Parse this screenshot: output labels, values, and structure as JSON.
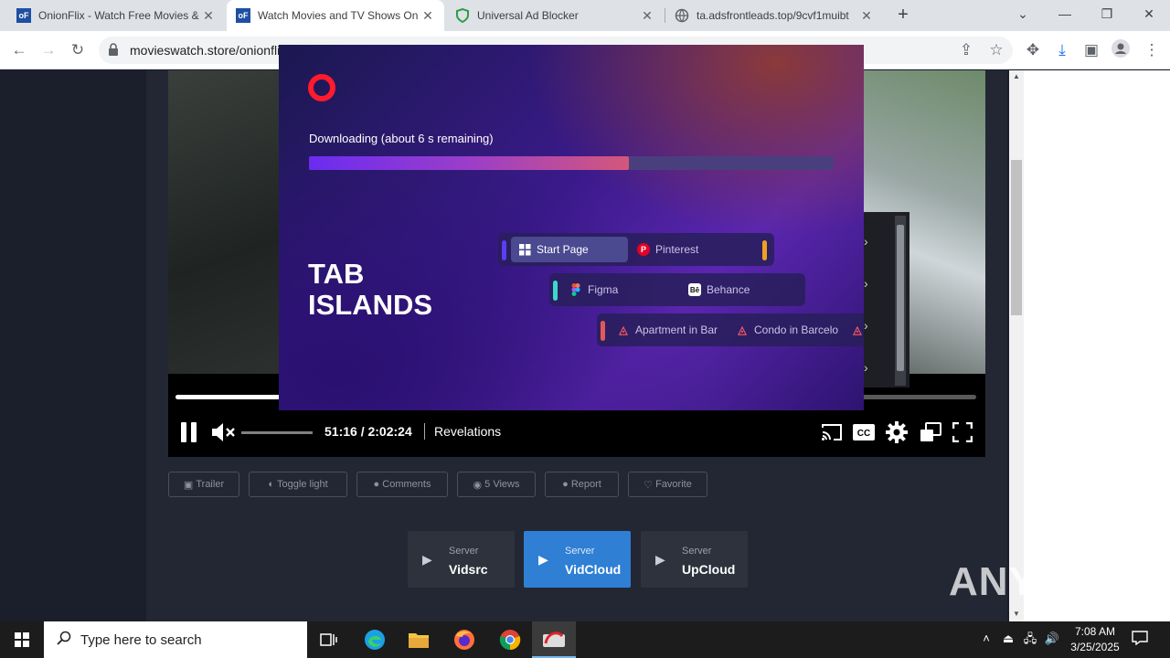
{
  "browser": {
    "tabs": [
      {
        "title": "OnionFlix - Watch Free Movies &",
        "favicon": "oF"
      },
      {
        "title": "Watch Movies and TV Shows On",
        "favicon": "oF"
      },
      {
        "title": "Universal Ad Blocker",
        "favicon": "shield"
      },
      {
        "title": "ta.adsfrontleads.top/9cvf1muibt",
        "favicon": "globe"
      }
    ],
    "active_tab": 1,
    "url": "movieswatch.store/onionfli"
  },
  "player": {
    "time": "51:16 / 2:02:24",
    "chapter": "Revelations",
    "progress": 0.42
  },
  "actions": [
    {
      "icon": "▣",
      "label": "Trailer"
    },
    {
      "icon": "◐",
      "label": "Toggle light"
    },
    {
      "icon": "●",
      "label": "Comments"
    },
    {
      "icon": "◉",
      "label": "5 Views"
    },
    {
      "icon": "●",
      "label": "Report"
    },
    {
      "icon": "♡",
      "label": "Favorite"
    }
  ],
  "servers": [
    {
      "label": "Server",
      "name": "Vidsrc",
      "active": false
    },
    {
      "label": "Server",
      "name": "VidCloud",
      "active": true
    },
    {
      "label": "Server",
      "name": "UpCloud",
      "active": false
    }
  ],
  "popup": {
    "download_text": "Downloading (about 6 s remaining)",
    "download_progress": 0.61,
    "headline_line1": "TAB",
    "headline_line2": "ISLANDS",
    "islands": {
      "row1": [
        "Start Page",
        "Pinterest"
      ],
      "row2": [
        "Figma",
        "Behance"
      ],
      "row3": [
        "Apartment in Bar",
        "Condo in Barcelo"
      ]
    }
  },
  "watermark": "ANY RUN",
  "taskbar": {
    "search_placeholder": "Type here to search",
    "time": "7:08 AM",
    "date": "3/25/2025"
  },
  "colors": {
    "accent_blue": "#2f7fd4",
    "opera_red": "#ff1b2d"
  }
}
